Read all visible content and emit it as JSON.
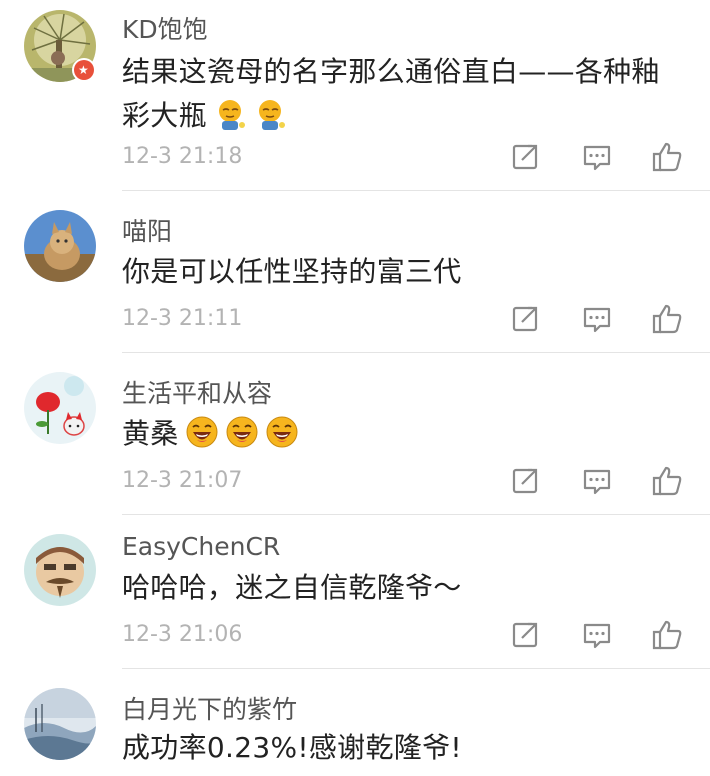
{
  "comments": [
    {
      "username": "KD饱饱",
      "content": "结果这瓷母的名字那么通俗直白——各种釉彩大瓶",
      "emoji": [
        "sleepy-emoji",
        "sleepy-emoji"
      ],
      "timestamp": "12-3 21:18",
      "avatar_badge": "vip-badge-icon"
    },
    {
      "username": "喵阳",
      "content": "你是可以任性坚持的富三代",
      "emoji": [],
      "timestamp": "12-3 21:11"
    },
    {
      "username": "生活平和从容",
      "content": "黄桑",
      "emoji": [
        "laughing-emoji",
        "laughing-emoji",
        "laughing-emoji"
      ],
      "timestamp": "12-3 21:07"
    },
    {
      "username": "EasyChenCR",
      "content": "哈哈哈，迷之自信乾隆爷～",
      "emoji": [],
      "timestamp": "12-3 21:06"
    },
    {
      "username": "白月光下的紫竹",
      "content": "成功率0.23%!感谢乾隆爷!",
      "emoji": [],
      "timestamp": ""
    }
  ],
  "actions": {
    "forward_icon": "forward-icon",
    "comment_icon": "comment-icon",
    "like_icon": "like-icon"
  },
  "colors": {
    "username": "#555555",
    "content": "#222222",
    "timestamp": "#b3b3b3",
    "icon": "#8a8a8a",
    "divider": "#e4e4e4",
    "badge": "#e8503a",
    "emoji_face": "#f6b51e"
  }
}
